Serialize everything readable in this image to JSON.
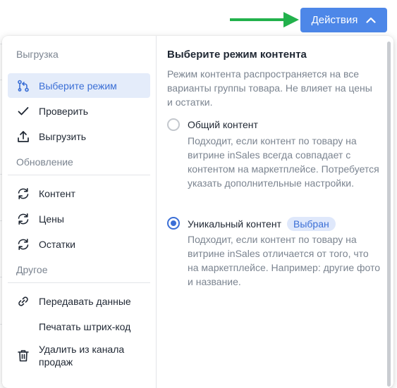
{
  "header": {
    "actions_label": "Действия",
    "accent": "#4d87e8"
  },
  "annotation": {
    "arrow_color": "#22b14c"
  },
  "menu": {
    "sections": [
      {
        "title": "Выгрузка",
        "items": [
          {
            "label": "Выберите режим",
            "icon": "branch-icon",
            "active": true
          },
          {
            "label": "Проверить",
            "icon": "check-icon"
          },
          {
            "label": "Выгрузить",
            "icon": "upload-icon"
          }
        ]
      },
      {
        "title": "Обновление",
        "items": [
          {
            "label": "Контент",
            "icon": "sync-icon"
          },
          {
            "label": "Цены",
            "icon": "sync-icon"
          },
          {
            "label": "Остатки",
            "icon": "sync-icon"
          }
        ]
      },
      {
        "title": "Другое",
        "items": [
          {
            "label": "Передавать данные",
            "icon": "link-icon"
          },
          {
            "label": "Печатать штрих-код",
            "icon": ""
          },
          {
            "label": "Удалить из канала продаж",
            "icon": "trash-icon"
          }
        ]
      }
    ]
  },
  "content": {
    "heading": "Выберите режим контента",
    "description": "Режим контента распространяется на все варианты группы товара. Не влияет на цены и остатки.",
    "options": [
      {
        "title": "Общий контент",
        "selected": false,
        "description": "Подходит, если контент по товару на витрине inSales всегда совпадает с контентом на маркетплейсе. Потребуется указать дополнительные настройки."
      },
      {
        "title": "Уникальный контент",
        "selected": true,
        "badge": "Выбран",
        "description": "Подходит, если контент по товару на витрине inSales отличается от того, что на маркетплейсе. Например: другие фото и название."
      }
    ]
  }
}
